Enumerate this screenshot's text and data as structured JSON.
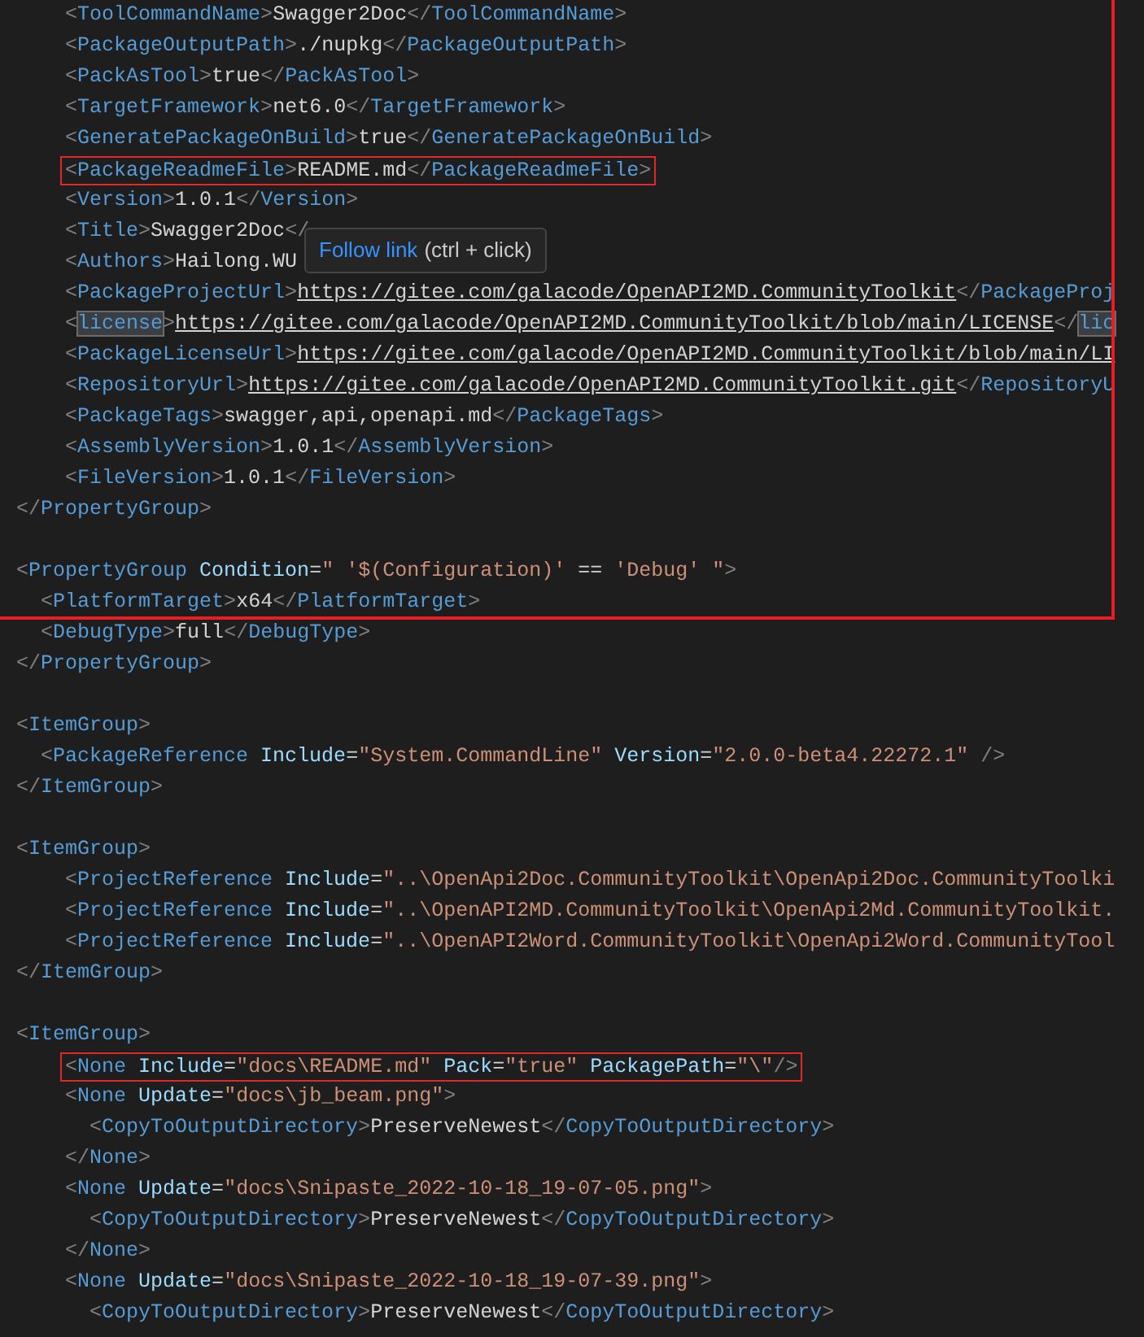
{
  "editor": {
    "lines": [
      {
        "kind": "code",
        "tokens": [
          {
            "kind": "punct",
            "text": "    <"
          },
          {
            "kind": "tag",
            "text": "ToolCommandName"
          },
          {
            "kind": "punct",
            "text": ">"
          },
          {
            "kind": "text",
            "text": "Swagger2Doc"
          },
          {
            "kind": "punct",
            "text": "</"
          },
          {
            "kind": "tag",
            "text": "ToolCommandName"
          },
          {
            "kind": "punct",
            "text": ">"
          }
        ]
      },
      {
        "kind": "code",
        "tokens": [
          {
            "kind": "punct",
            "text": "    <"
          },
          {
            "kind": "tag",
            "text": "PackageOutputPath"
          },
          {
            "kind": "punct",
            "text": ">"
          },
          {
            "kind": "text",
            "text": "./nupkg"
          },
          {
            "kind": "punct",
            "text": "</"
          },
          {
            "kind": "tag",
            "text": "PackageOutputPath"
          },
          {
            "kind": "punct",
            "text": ">"
          }
        ]
      },
      {
        "kind": "code",
        "tokens": [
          {
            "kind": "punct",
            "text": "    <"
          },
          {
            "kind": "tag",
            "text": "PackAsTool"
          },
          {
            "kind": "punct",
            "text": ">"
          },
          {
            "kind": "text",
            "text": "true"
          },
          {
            "kind": "punct",
            "text": "</"
          },
          {
            "kind": "tag",
            "text": "PackAsTool"
          },
          {
            "kind": "punct",
            "text": ">"
          }
        ]
      },
      {
        "kind": "code",
        "tokens": [
          {
            "kind": "punct",
            "text": "    <"
          },
          {
            "kind": "tag",
            "text": "TargetFramework"
          },
          {
            "kind": "punct",
            "text": ">"
          },
          {
            "kind": "text",
            "text": "net6.0"
          },
          {
            "kind": "punct",
            "text": "</"
          },
          {
            "kind": "tag",
            "text": "TargetFramework"
          },
          {
            "kind": "punct",
            "text": ">"
          }
        ]
      },
      {
        "kind": "code",
        "tokens": [
          {
            "kind": "punct",
            "text": "    <"
          },
          {
            "kind": "tag",
            "text": "GeneratePackageOnBuild"
          },
          {
            "kind": "punct",
            "text": ">"
          },
          {
            "kind": "text",
            "text": "true"
          },
          {
            "kind": "punct",
            "text": "</"
          },
          {
            "kind": "tag",
            "text": "GeneratePackageOnBuild"
          },
          {
            "kind": "punct",
            "text": ">"
          }
        ]
      },
      {
        "kind": "code",
        "boxed": true,
        "tokens": [
          {
            "kind": "punct",
            "text": "<"
          },
          {
            "kind": "tag",
            "text": "PackageReadmeFile"
          },
          {
            "kind": "punct",
            "text": ">"
          },
          {
            "kind": "text",
            "text": "README.md"
          },
          {
            "kind": "punct",
            "text": "</"
          },
          {
            "kind": "tag",
            "text": "PackageReadmeFile"
          },
          {
            "kind": "punct",
            "text": ">"
          }
        ]
      },
      {
        "kind": "code",
        "tokens": [
          {
            "kind": "punct",
            "text": "    <"
          },
          {
            "kind": "tag",
            "text": "Version"
          },
          {
            "kind": "punct",
            "text": ">"
          },
          {
            "kind": "text",
            "text": "1.0.1"
          },
          {
            "kind": "punct",
            "text": "</"
          },
          {
            "kind": "tag",
            "text": "Version"
          },
          {
            "kind": "punct",
            "text": ">"
          }
        ]
      },
      {
        "kind": "code",
        "tokens": [
          {
            "kind": "punct",
            "text": "    <"
          },
          {
            "kind": "tag",
            "text": "Title"
          },
          {
            "kind": "punct",
            "text": ">"
          },
          {
            "kind": "text",
            "text": "Swagger2Doc"
          },
          {
            "kind": "punct",
            "text": "</"
          }
        ]
      },
      {
        "kind": "code",
        "tokens": [
          {
            "kind": "punct",
            "text": "    <"
          },
          {
            "kind": "tag",
            "text": "Authors"
          },
          {
            "kind": "punct",
            "text": ">"
          },
          {
            "kind": "text",
            "text": "Hailong.WU"
          }
        ]
      },
      {
        "kind": "code",
        "tokens": [
          {
            "kind": "punct",
            "text": "    <"
          },
          {
            "kind": "tag",
            "text": "PackageProjectUrl"
          },
          {
            "kind": "punct",
            "text": ">"
          },
          {
            "kind": "link",
            "text": "https://gitee.com/galacode/OpenAPI2MD.CommunityToolkit"
          },
          {
            "kind": "punct",
            "text": "</"
          },
          {
            "kind": "tag",
            "text": "PackageProj"
          }
        ]
      },
      {
        "kind": "code",
        "tokens": [
          {
            "kind": "punct",
            "text": "    <"
          },
          {
            "kind": "tag",
            "text": "license",
            "highlighted": true
          },
          {
            "kind": "punct",
            "text": ">"
          },
          {
            "kind": "link",
            "text": "https://gitee.com/galacode/OpenAPI2MD.CommunityToolkit/blob/main/LICENSE"
          },
          {
            "kind": "punct",
            "text": "</"
          },
          {
            "kind": "tag",
            "text": "lic",
            "highlighted": true
          }
        ]
      },
      {
        "kind": "code",
        "tokens": [
          {
            "kind": "punct",
            "text": "    <"
          },
          {
            "kind": "tag",
            "text": "PackageLicenseUrl"
          },
          {
            "kind": "punct",
            "text": ">"
          },
          {
            "kind": "link",
            "text": "https://gitee.com/galacode/OpenAPI2MD.CommunityToolkit/blob/main/LI"
          }
        ]
      },
      {
        "kind": "code",
        "tokens": [
          {
            "kind": "punct",
            "text": "    <"
          },
          {
            "kind": "tag",
            "text": "RepositoryUrl"
          },
          {
            "kind": "punct",
            "text": ">"
          },
          {
            "kind": "link",
            "text": "https://gitee.com/galacode/OpenAPI2MD.CommunityToolkit.git"
          },
          {
            "kind": "punct",
            "text": "</"
          },
          {
            "kind": "tag",
            "text": "RepositoryU"
          }
        ]
      },
      {
        "kind": "code",
        "tokens": [
          {
            "kind": "punct",
            "text": "    <"
          },
          {
            "kind": "tag",
            "text": "PackageTags"
          },
          {
            "kind": "punct",
            "text": ">"
          },
          {
            "kind": "text",
            "text": "swagger,api,openapi.md"
          },
          {
            "kind": "punct",
            "text": "</"
          },
          {
            "kind": "tag",
            "text": "PackageTags"
          },
          {
            "kind": "punct",
            "text": ">"
          }
        ]
      },
      {
        "kind": "code",
        "tokens": [
          {
            "kind": "punct",
            "text": "    <"
          },
          {
            "kind": "tag",
            "text": "AssemblyVersion"
          },
          {
            "kind": "punct",
            "text": ">"
          },
          {
            "kind": "text",
            "text": "1.0.1"
          },
          {
            "kind": "punct",
            "text": "</"
          },
          {
            "kind": "tag",
            "text": "AssemblyVersion"
          },
          {
            "kind": "punct",
            "text": ">"
          }
        ]
      },
      {
        "kind": "code",
        "tokens": [
          {
            "kind": "punct",
            "text": "    <"
          },
          {
            "kind": "tag",
            "text": "FileVersion"
          },
          {
            "kind": "punct",
            "text": ">"
          },
          {
            "kind": "text",
            "text": "1.0.1"
          },
          {
            "kind": "punct",
            "text": "</"
          },
          {
            "kind": "tag",
            "text": "FileVersion"
          },
          {
            "kind": "punct",
            "text": ">"
          }
        ]
      },
      {
        "kind": "code",
        "tokens": [
          {
            "kind": "punct",
            "text": "</"
          },
          {
            "kind": "tag",
            "text": "PropertyGroup"
          },
          {
            "kind": "punct",
            "text": ">"
          }
        ]
      },
      {
        "kind": "blank"
      },
      {
        "kind": "code",
        "tokens": [
          {
            "kind": "punct",
            "text": "<"
          },
          {
            "kind": "tag",
            "text": "PropertyGroup"
          },
          {
            "kind": "attr",
            "text": " Condition"
          },
          {
            "kind": "text",
            "text": "="
          },
          {
            "kind": "string",
            "text": "\" '$(Configuration)'"
          },
          {
            "kind": "text",
            "text": " == "
          },
          {
            "kind": "string",
            "text": "'Debug' \""
          },
          {
            "kind": "punct",
            "text": ">"
          }
        ]
      },
      {
        "kind": "code",
        "tokens": [
          {
            "kind": "punct",
            "text": "  <"
          },
          {
            "kind": "tag",
            "text": "PlatformTarget"
          },
          {
            "kind": "punct",
            "text": ">"
          },
          {
            "kind": "text",
            "text": "x64"
          },
          {
            "kind": "punct",
            "text": "</"
          },
          {
            "kind": "tag",
            "text": "PlatformTarget"
          },
          {
            "kind": "punct",
            "text": ">"
          }
        ]
      },
      {
        "kind": "code",
        "tokens": [
          {
            "kind": "punct",
            "text": "  <"
          },
          {
            "kind": "tag",
            "text": "DebugType"
          },
          {
            "kind": "punct",
            "text": ">"
          },
          {
            "kind": "text",
            "text": "full"
          },
          {
            "kind": "punct",
            "text": "</"
          },
          {
            "kind": "tag",
            "text": "DebugType"
          },
          {
            "kind": "punct",
            "text": ">"
          }
        ]
      },
      {
        "kind": "code",
        "tokens": [
          {
            "kind": "punct",
            "text": "</"
          },
          {
            "kind": "tag",
            "text": "PropertyGroup"
          },
          {
            "kind": "punct",
            "text": ">"
          }
        ]
      },
      {
        "kind": "blank"
      },
      {
        "kind": "code",
        "tokens": [
          {
            "kind": "punct",
            "text": "<"
          },
          {
            "kind": "tag",
            "text": "ItemGroup"
          },
          {
            "kind": "punct",
            "text": ">"
          }
        ]
      },
      {
        "kind": "code",
        "tokens": [
          {
            "kind": "punct",
            "text": "  <"
          },
          {
            "kind": "tag",
            "text": "PackageReference"
          },
          {
            "kind": "attr",
            "text": " Include"
          },
          {
            "kind": "text",
            "text": "="
          },
          {
            "kind": "string",
            "text": "\"System.CommandLine\""
          },
          {
            "kind": "attr",
            "text": " Version"
          },
          {
            "kind": "text",
            "text": "="
          },
          {
            "kind": "string",
            "text": "\"2.0.0-beta4.22272.1\""
          },
          {
            "kind": "punct",
            "text": " />"
          }
        ]
      },
      {
        "kind": "code",
        "tokens": [
          {
            "kind": "punct",
            "text": "</"
          },
          {
            "kind": "tag",
            "text": "ItemGroup"
          },
          {
            "kind": "punct",
            "text": ">"
          }
        ]
      },
      {
        "kind": "blank"
      },
      {
        "kind": "code",
        "tokens": [
          {
            "kind": "punct",
            "text": "<"
          },
          {
            "kind": "tag",
            "text": "ItemGroup"
          },
          {
            "kind": "punct",
            "text": ">"
          }
        ]
      },
      {
        "kind": "code",
        "tokens": [
          {
            "kind": "punct",
            "text": "    <"
          },
          {
            "kind": "tag",
            "text": "ProjectReference"
          },
          {
            "kind": "attr",
            "text": " Include"
          },
          {
            "kind": "text",
            "text": "="
          },
          {
            "kind": "string",
            "text": "\"..\\OpenApi2Doc.CommunityToolkit\\OpenApi2Doc.CommunityToolki"
          }
        ]
      },
      {
        "kind": "code",
        "tokens": [
          {
            "kind": "punct",
            "text": "    <"
          },
          {
            "kind": "tag",
            "text": "ProjectReference"
          },
          {
            "kind": "attr",
            "text": " Include"
          },
          {
            "kind": "text",
            "text": "="
          },
          {
            "kind": "string",
            "text": "\"..\\OpenAPI2MD.CommunityToolkit\\OpenApi2Md.CommunityToolkit."
          }
        ]
      },
      {
        "kind": "code",
        "tokens": [
          {
            "kind": "punct",
            "text": "    <"
          },
          {
            "kind": "tag",
            "text": "ProjectReference"
          },
          {
            "kind": "attr",
            "text": " Include"
          },
          {
            "kind": "text",
            "text": "="
          },
          {
            "kind": "string",
            "text": "\"..\\OpenAPI2Word.CommunityToolkit\\OpenApi2Word.CommunityTool"
          }
        ]
      },
      {
        "kind": "code",
        "tokens": [
          {
            "kind": "punct",
            "text": "</"
          },
          {
            "kind": "tag",
            "text": "ItemGroup"
          },
          {
            "kind": "punct",
            "text": ">"
          }
        ]
      },
      {
        "kind": "blank"
      },
      {
        "kind": "code",
        "tokens": [
          {
            "kind": "punct",
            "text": "<"
          },
          {
            "kind": "tag",
            "text": "ItemGroup"
          },
          {
            "kind": "punct",
            "text": ">"
          }
        ]
      },
      {
        "kind": "code",
        "boxed": true,
        "tokens": [
          {
            "kind": "punct",
            "text": "<"
          },
          {
            "kind": "tag",
            "text": "None"
          },
          {
            "kind": "attr",
            "text": " Include"
          },
          {
            "kind": "text",
            "text": "="
          },
          {
            "kind": "string",
            "text": "\"docs\\README.md\""
          },
          {
            "kind": "attr",
            "text": " Pack"
          },
          {
            "kind": "text",
            "text": "="
          },
          {
            "kind": "string",
            "text": "\"true\""
          },
          {
            "kind": "attr",
            "text": " PackagePath"
          },
          {
            "kind": "text",
            "text": "="
          },
          {
            "kind": "string",
            "text": "\"\\\""
          },
          {
            "kind": "punct",
            "text": "/>"
          }
        ]
      },
      {
        "kind": "code",
        "tokens": [
          {
            "kind": "punct",
            "text": "    <"
          },
          {
            "kind": "tag",
            "text": "None"
          },
          {
            "kind": "attr",
            "text": " Update"
          },
          {
            "kind": "text",
            "text": "="
          },
          {
            "kind": "string",
            "text": "\"docs\\jb_beam.png\""
          },
          {
            "kind": "punct",
            "text": ">"
          }
        ]
      },
      {
        "kind": "code",
        "tokens": [
          {
            "kind": "punct",
            "text": "      <"
          },
          {
            "kind": "tag",
            "text": "CopyToOutputDirectory"
          },
          {
            "kind": "punct",
            "text": ">"
          },
          {
            "kind": "text",
            "text": "PreserveNewest"
          },
          {
            "kind": "punct",
            "text": "</"
          },
          {
            "kind": "tag",
            "text": "CopyToOutputDirectory"
          },
          {
            "kind": "punct",
            "text": ">"
          }
        ]
      },
      {
        "kind": "code",
        "tokens": [
          {
            "kind": "punct",
            "text": "    </"
          },
          {
            "kind": "tag",
            "text": "None"
          },
          {
            "kind": "punct",
            "text": ">"
          }
        ]
      },
      {
        "kind": "code",
        "tokens": [
          {
            "kind": "punct",
            "text": "    <"
          },
          {
            "kind": "tag",
            "text": "None"
          },
          {
            "kind": "attr",
            "text": " Update"
          },
          {
            "kind": "text",
            "text": "="
          },
          {
            "kind": "string",
            "text": "\"docs\\Snipaste_2022-10-18_19-07-05.png\""
          },
          {
            "kind": "punct",
            "text": ">"
          }
        ]
      },
      {
        "kind": "code",
        "tokens": [
          {
            "kind": "punct",
            "text": "      <"
          },
          {
            "kind": "tag",
            "text": "CopyToOutputDirectory"
          },
          {
            "kind": "punct",
            "text": ">"
          },
          {
            "kind": "text",
            "text": "PreserveNewest"
          },
          {
            "kind": "punct",
            "text": "</"
          },
          {
            "kind": "tag",
            "text": "CopyToOutputDirectory"
          },
          {
            "kind": "punct",
            "text": ">"
          }
        ]
      },
      {
        "kind": "code",
        "tokens": [
          {
            "kind": "punct",
            "text": "    </"
          },
          {
            "kind": "tag",
            "text": "None"
          },
          {
            "kind": "punct",
            "text": ">"
          }
        ]
      },
      {
        "kind": "code",
        "tokens": [
          {
            "kind": "punct",
            "text": "    <"
          },
          {
            "kind": "tag",
            "text": "None"
          },
          {
            "kind": "attr",
            "text": " Update"
          },
          {
            "kind": "text",
            "text": "="
          },
          {
            "kind": "string",
            "text": "\"docs\\Snipaste_2022-10-18_19-07-39.png\""
          },
          {
            "kind": "punct",
            "text": ">"
          }
        ]
      },
      {
        "kind": "code",
        "tokens": [
          {
            "kind": "punct",
            "text": "      <"
          },
          {
            "kind": "tag",
            "text": "CopyToOutputDirectory"
          },
          {
            "kind": "punct",
            "text": ">"
          },
          {
            "kind": "text",
            "text": "PreserveNewest"
          },
          {
            "kind": "punct",
            "text": "</"
          },
          {
            "kind": "tag",
            "text": "CopyToOutputDirectory"
          },
          {
            "kind": "punct",
            "text": ">"
          }
        ]
      }
    ]
  },
  "tooltip": {
    "link_text": "Follow link",
    "hint": "(ctrl + click)"
  }
}
